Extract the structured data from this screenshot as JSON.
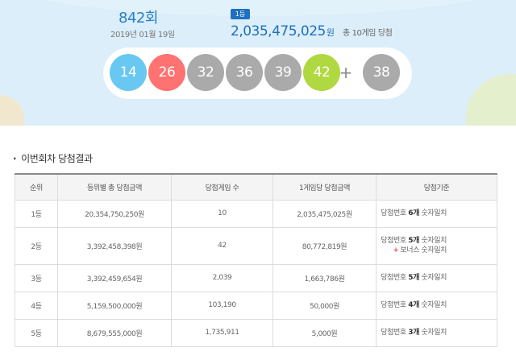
{
  "draw": {
    "round": "842회",
    "date": "2019년 01월 19일",
    "rank_badge": "1등",
    "first_prize_amount": "2,035,475,025",
    "first_prize_unit": "원",
    "winners_note": "총 10게임 당첨"
  },
  "balls": [
    {
      "number": "14",
      "color": "#69c8f2"
    },
    {
      "number": "26",
      "color": "#ff7272"
    },
    {
      "number": "32",
      "color": "#aaaaaa"
    },
    {
      "number": "36",
      "color": "#aaaaaa"
    },
    {
      "number": "39",
      "color": "#aaaaaa"
    },
    {
      "number": "42",
      "color": "#b0d840"
    }
  ],
  "plus_sign": "+",
  "bonus_ball": {
    "number": "38",
    "color": "#aaaaaa"
  },
  "results": {
    "section_title": "이번회차 당첨결과",
    "columns": [
      "순위",
      "등위별 총 당첨금액",
      "당첨게임 수",
      "1게임당 당첨금액",
      "당첨기준"
    ],
    "rows": [
      {
        "rank": "1등",
        "total": "20,354,750,250원",
        "games": "10",
        "per_game": "2,035,475,025원",
        "crit_pre": "당첨번호 ",
        "crit_bold": "6개",
        "crit_post": " 숫자일치",
        "bonus": ""
      },
      {
        "rank": "2등",
        "total": "3,392,458,398원",
        "games": "42",
        "per_game": "80,772,819원",
        "crit_pre": "당첨번호 ",
        "crit_bold": "5개",
        "crit_post": " 숫자일치",
        "bonus": "보너스 숫자일치"
      },
      {
        "rank": "3등",
        "total": "3,392,459,654원",
        "games": "2,039",
        "per_game": "1,663,786원",
        "crit_pre": "당첨번호 ",
        "crit_bold": "5개",
        "crit_post": " 숫자일치",
        "bonus": ""
      },
      {
        "rank": "4등",
        "total": "5,159,500,000원",
        "games": "103,190",
        "per_game": "50,000원",
        "crit_pre": "당첨번호 ",
        "crit_bold": "4개",
        "crit_post": " 숫자일치",
        "bonus": ""
      },
      {
        "rank": "5등",
        "total": "8,679,555,000원",
        "games": "1,735,911",
        "per_game": "5,000원",
        "crit_pre": "당첨번호 ",
        "crit_bold": "3개",
        "crit_post": " 숫자일치",
        "bonus": ""
      }
    ]
  },
  "colors": {
    "accent_blue": "#1f6fbf",
    "hero_background": "#dbeef9"
  }
}
